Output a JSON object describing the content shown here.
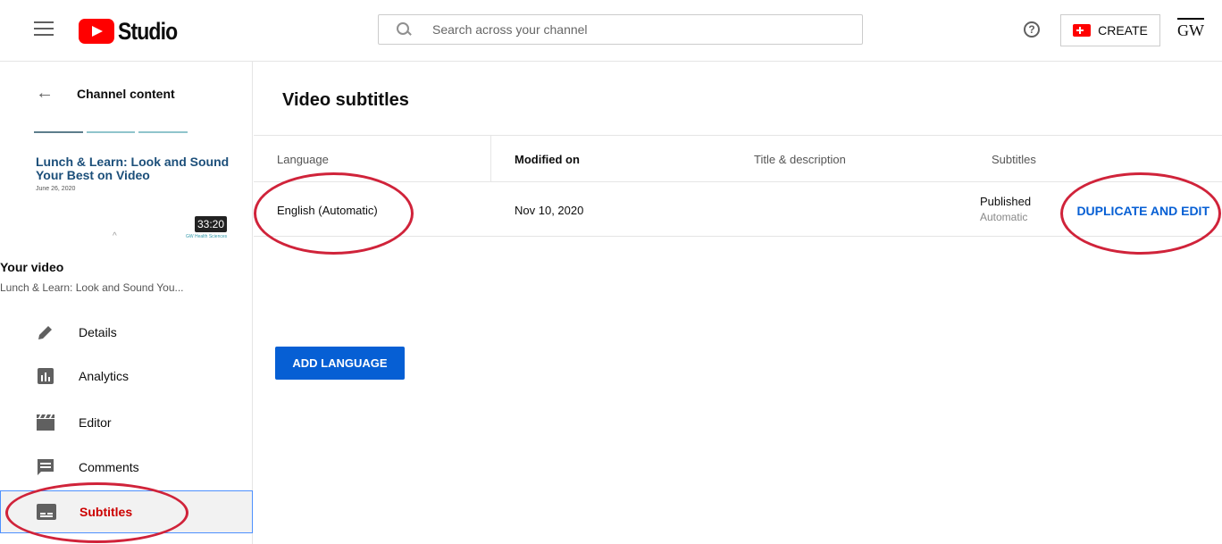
{
  "header": {
    "logo_text": "Studio",
    "search_placeholder": "Search across your channel",
    "help_symbol": "?",
    "create_label": "CREATE",
    "avatar_text": "GW"
  },
  "sidebar": {
    "back_label": "Channel content",
    "thumbnail": {
      "title": "Lunch & Learn: Look and Sound Your Best on Video",
      "date": "June 26, 2020",
      "duration": "33:20",
      "sub_logo": "GW Health Sciences"
    },
    "your_video_label": "Your video",
    "video_name": "Lunch & Learn: Look and Sound You...",
    "items": [
      {
        "label": "Details",
        "icon": "pencil-icon"
      },
      {
        "label": "Analytics",
        "icon": "analytics-icon"
      },
      {
        "label": "Editor",
        "icon": "clapper-icon"
      },
      {
        "label": "Comments",
        "icon": "comment-icon"
      },
      {
        "label": "Subtitles",
        "icon": "subtitles-icon",
        "active": true
      }
    ]
  },
  "main": {
    "title": "Video subtitles",
    "columns": [
      "Language",
      "Modified on",
      "Title & description",
      "Subtitles"
    ],
    "rows": [
      {
        "language": "English (Automatic)",
        "modified": "Nov 10, 2020",
        "title_description": "",
        "status": "Published",
        "status_sub": "Automatic",
        "action": "DUPLICATE AND EDIT"
      }
    ],
    "add_language_label": "ADD LANGUAGE"
  },
  "colors": {
    "brand_red": "#ff0000",
    "accent_blue": "#065fd4",
    "annotation_red": "#d0233a",
    "active_label_red": "#cc0000"
  }
}
